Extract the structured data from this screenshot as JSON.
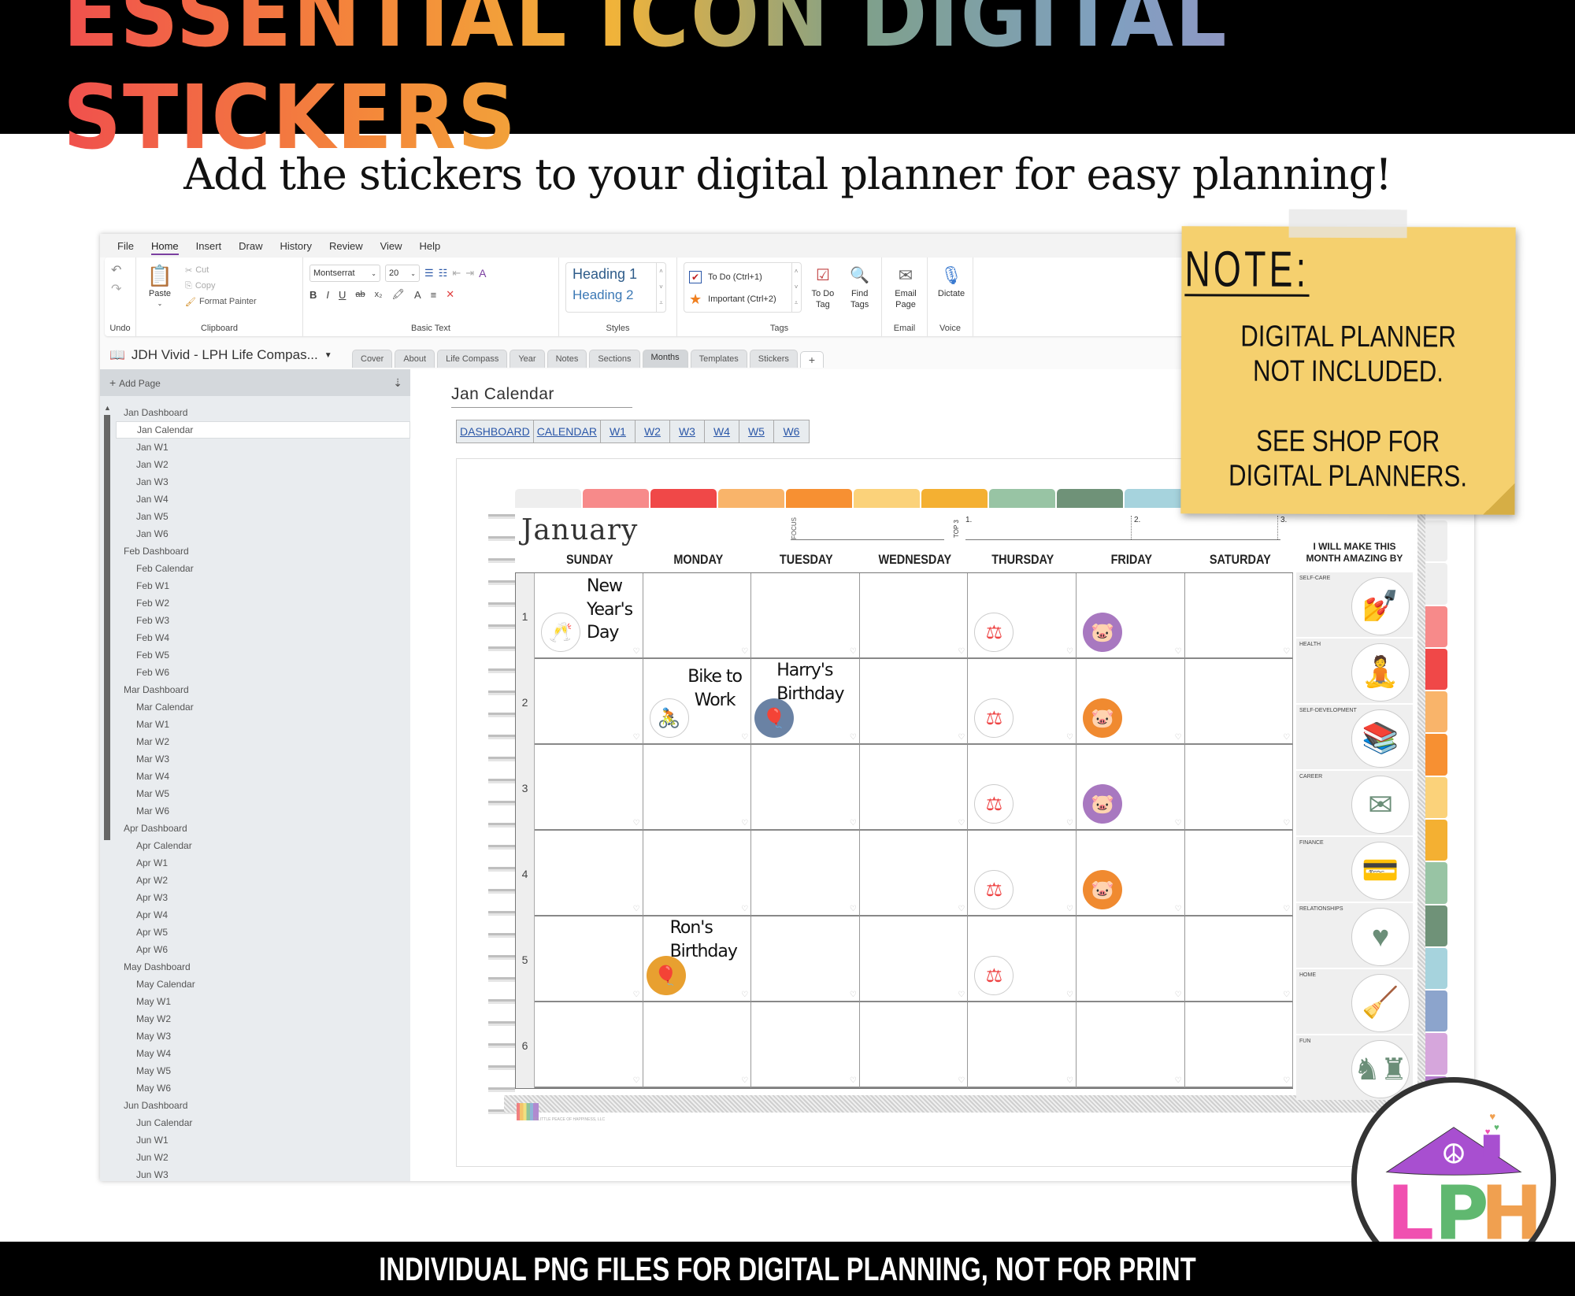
{
  "banner": {
    "title": "essential icon digital stickers",
    "subtitle": "Add the stickers to your digital planner for easy planning!"
  },
  "app": {
    "menu": [
      "File",
      "Home",
      "Insert",
      "Draw",
      "History",
      "Review",
      "View",
      "Help"
    ],
    "active_menu": "Home",
    "ribbon": {
      "undo_group": "Undo",
      "clipboard": {
        "paste": "Paste",
        "cut": "Cut",
        "copy": "Copy",
        "format_painter": "Format Painter",
        "label": "Clipboard"
      },
      "basic_text": {
        "font": "Montserrat",
        "size": "20",
        "label": "Basic Text",
        "bold": "B",
        "italic": "I",
        "underline": "U",
        "strike": "ab",
        "subscript": "x₂",
        "font_color": "A"
      },
      "styles": {
        "h1": "Heading 1",
        "h2": "Heading 2",
        "label": "Styles"
      },
      "tags": {
        "todo": "To Do (Ctrl+1)",
        "important": "Important (Ctrl+2)",
        "todo_tag": "To Do Tag",
        "find_tags": "Find Tags",
        "label": "Tags"
      },
      "email": {
        "btn": "Email Page",
        "label": "Email"
      },
      "voice": {
        "btn": "Dictate",
        "label": "Voice"
      }
    },
    "notebook_name": "JDH Vivid - LPH Life Compas...",
    "section_tabs": [
      "Cover",
      "About",
      "Life Compass",
      "Year",
      "Notes",
      "Sections",
      "Months",
      "Templates",
      "Stickers",
      "+"
    ],
    "active_tab": "Months",
    "sidebar": {
      "add_page": "Add Page",
      "pages": [
        {
          "label": "Jan Dashboard",
          "level": 1
        },
        {
          "label": "Jan Calendar",
          "level": 2,
          "selected": true
        },
        {
          "label": "Jan W1",
          "level": 2
        },
        {
          "label": "Jan W2",
          "level": 2
        },
        {
          "label": "Jan W3",
          "level": 2
        },
        {
          "label": "Jan W4",
          "level": 2
        },
        {
          "label": "Jan W5",
          "level": 2
        },
        {
          "label": "Jan W6",
          "level": 2
        },
        {
          "label": "Feb Dashboard",
          "level": 1
        },
        {
          "label": "Feb Calendar",
          "level": 2
        },
        {
          "label": "Feb W1",
          "level": 2
        },
        {
          "label": "Feb W2",
          "level": 2
        },
        {
          "label": "Feb W3",
          "level": 2
        },
        {
          "label": "Feb W4",
          "level": 2
        },
        {
          "label": "Feb W5",
          "level": 2
        },
        {
          "label": "Feb W6",
          "level": 2
        },
        {
          "label": "Mar Dashboard",
          "level": 1
        },
        {
          "label": "Mar Calendar",
          "level": 2
        },
        {
          "label": "Mar W1",
          "level": 2
        },
        {
          "label": "Mar W2",
          "level": 2
        },
        {
          "label": "Mar W3",
          "level": 2
        },
        {
          "label": "Mar W4",
          "level": 2
        },
        {
          "label": "Mar W5",
          "level": 2
        },
        {
          "label": "Mar W6",
          "level": 2
        },
        {
          "label": "Apr Dashboard",
          "level": 1
        },
        {
          "label": "Apr Calendar",
          "level": 2
        },
        {
          "label": "Apr W1",
          "level": 2
        },
        {
          "label": "Apr W2",
          "level": 2
        },
        {
          "label": "Apr W3",
          "level": 2
        },
        {
          "label": "Apr W4",
          "level": 2
        },
        {
          "label": "Apr W5",
          "level": 2
        },
        {
          "label": "Apr W6",
          "level": 2
        },
        {
          "label": "May Dashboard",
          "level": 1
        },
        {
          "label": "May Calendar",
          "level": 2
        },
        {
          "label": "May W1",
          "level": 2
        },
        {
          "label": "May W2",
          "level": 2
        },
        {
          "label": "May W3",
          "level": 2
        },
        {
          "label": "May W4",
          "level": 2
        },
        {
          "label": "May W5",
          "level": 2
        },
        {
          "label": "May W6",
          "level": 2
        },
        {
          "label": "Jun Dashboard",
          "level": 1
        },
        {
          "label": "Jun Calendar",
          "level": 2
        },
        {
          "label": "Jun W1",
          "level": 2
        },
        {
          "label": "Jun W2",
          "level": 2
        },
        {
          "label": "Jun W3",
          "level": 2
        }
      ]
    },
    "page": {
      "title": "Jan Calendar",
      "nav_links": [
        "DASHBOARD",
        "CALENDAR",
        "W1",
        "W2",
        "W3",
        "W4",
        "W5",
        "W6"
      ]
    }
  },
  "planner": {
    "month": "January",
    "focus_label": "FOCUS",
    "top3_label": "TOP 3",
    "top3_items": [
      "1.",
      "2.",
      "3."
    ],
    "amazing_heading": "I WILL MAKE THIS MONTH AMAZING BY",
    "days": [
      "SUNDAY",
      "MONDAY",
      "TUESDAY",
      "WEDNESDAY",
      "THURSDAY",
      "FRIDAY",
      "SATURDAY"
    ],
    "weeks": [
      "1",
      "2",
      "3",
      "4",
      "5",
      "6"
    ],
    "tab_colors": [
      "#eeeeee",
      "#f78a8a",
      "#f04848",
      "#f9b46a",
      "#f79032",
      "#fbd27a",
      "#f4b032",
      "#98c4a4",
      "#6f9278",
      "#a6d3dd"
    ],
    "side_tab_colors": [
      "#eeeeee",
      "#eeeeee",
      "#f78a8a",
      "#f04848",
      "#f9b46a",
      "#f79032",
      "#fbd27a",
      "#f4b032",
      "#98c4a4",
      "#6f9278",
      "#a6d3dd",
      "#8ca4cc",
      "#d6a6dc",
      "#b47ccc"
    ],
    "events": [
      {
        "week": 0,
        "day": 0,
        "text": "New Year's Day",
        "sticker": "champagne-icon",
        "sticker_style": "outline",
        "color": "#b08ad0"
      },
      {
        "week": 1,
        "day": 1,
        "text": "Bike to Work",
        "sticker": "bicycle-icon",
        "sticker_style": "outline",
        "color": "#f08a30"
      },
      {
        "week": 1,
        "day": 2,
        "text": "Harry's Birthday",
        "sticker": "balloons-icon",
        "sticker_style": "filled",
        "color": "#6a82a4"
      },
      {
        "week": 4,
        "day": 1,
        "text": "Ron's Birthday",
        "sticker": "balloons-icon",
        "sticker_style": "filled",
        "color": "#e8a030"
      }
    ],
    "stickers": [
      {
        "week": 0,
        "day": 4,
        "icon": "scale-icon",
        "style": "outline",
        "color": "#ee4444"
      },
      {
        "week": 0,
        "day": 5,
        "icon": "piggy-bank-icon",
        "style": "filled",
        "color": "#a878c0"
      },
      {
        "week": 1,
        "day": 4,
        "icon": "scale-icon",
        "style": "outline",
        "color": "#ee4444"
      },
      {
        "week": 1,
        "day": 5,
        "icon": "piggy-bank-icon",
        "style": "filled",
        "color": "#f08a30"
      },
      {
        "week": 2,
        "day": 4,
        "icon": "scale-icon",
        "style": "outline",
        "color": "#ee4444"
      },
      {
        "week": 2,
        "day": 5,
        "icon": "piggy-bank-icon",
        "style": "filled",
        "color": "#a878c0"
      },
      {
        "week": 3,
        "day": 4,
        "icon": "scale-icon",
        "style": "outline",
        "color": "#ee4444"
      },
      {
        "week": 3,
        "day": 5,
        "icon": "piggy-bank-icon",
        "style": "filled",
        "color": "#f08a30"
      },
      {
        "week": 4,
        "day": 4,
        "icon": "scale-icon",
        "style": "outline",
        "color": "#ee4444"
      }
    ],
    "categories": [
      {
        "label": "SELF-CARE",
        "icon": "nail-polish-icon",
        "glyph": "💅"
      },
      {
        "label": "HEALTH",
        "icon": "yoga-icon",
        "glyph": "🧘"
      },
      {
        "label": "SELF-DEVELOPMENT",
        "icon": "books-icon",
        "glyph": "📚"
      },
      {
        "label": "CAREER",
        "icon": "email-icon",
        "glyph": "✉"
      },
      {
        "label": "FINANCE",
        "icon": "no-credit-card-icon",
        "glyph": "💳"
      },
      {
        "label": "RELATIONSHIPS",
        "icon": "heart-icon",
        "glyph": "♥"
      },
      {
        "label": "HOME",
        "icon": "mop-bucket-icon",
        "glyph": "🧹"
      },
      {
        "label": "FUN",
        "icon": "chess-icon",
        "glyph": "♞♜"
      }
    ],
    "copyright": "© LITTLE PEACE OF HAPPINESS, LLC"
  },
  "note": {
    "title": "NOTE:",
    "line1": "DIGITAL PLANNER NOT INCLUDED.",
    "line2": "SEE SHOP FOR DIGITAL PLANNERS."
  },
  "logo": {
    "text": "LPH",
    "colors": {
      "roof": "#a84fd0",
      "L": "#f050b0",
      "P": "#60b870",
      "H": "#f0a050"
    }
  },
  "footer": {
    "text": "INDIVIDUAL PNG FILES FOR DIGITAL PLANNING, NOT FOR PRINT"
  }
}
